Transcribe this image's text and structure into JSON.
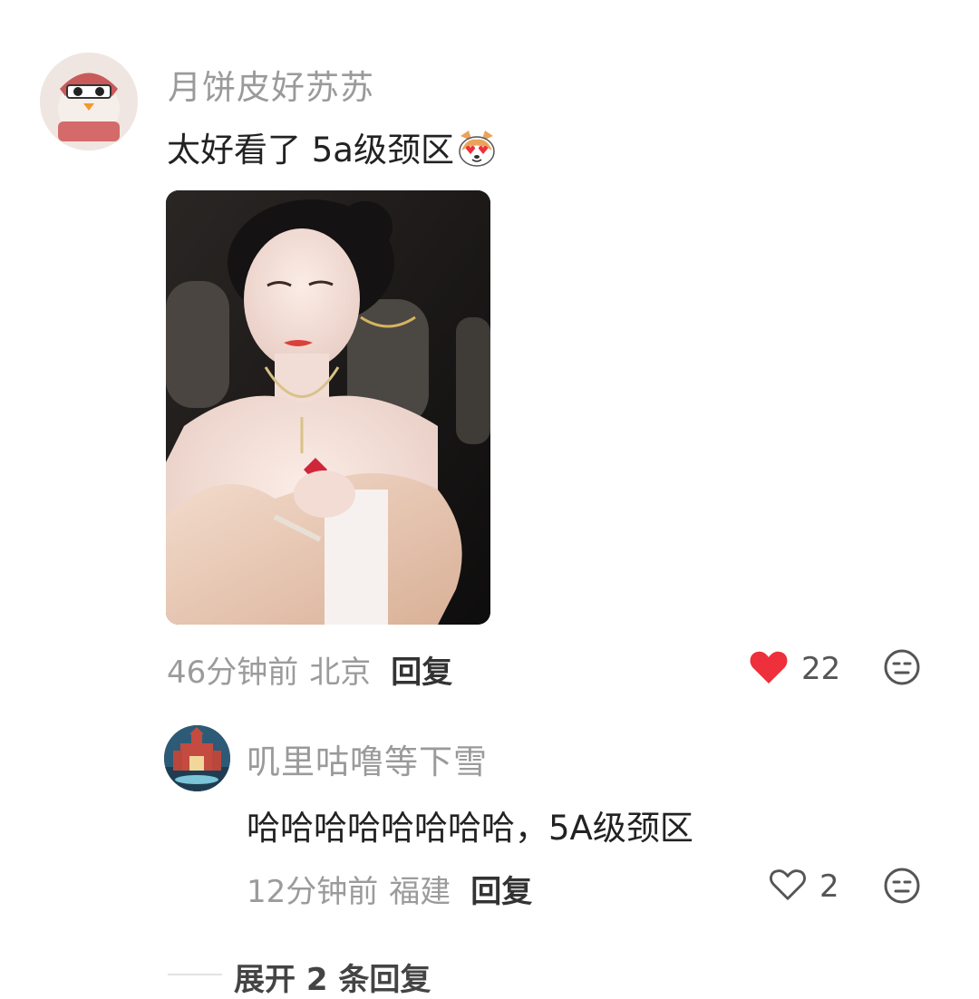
{
  "comments": [
    {
      "username": "月饼皮好苏苏",
      "text": "太好看了 5a级颈区",
      "emoji": "cat-heart-eyes-icon",
      "time": "46分钟前",
      "location": "北京",
      "reply_label": "回复",
      "likes": "22",
      "liked": true
    },
    {
      "username": "叽里咕噜等下雪",
      "text": "哈哈哈哈哈哈哈哈，5A级颈区",
      "time": "12分钟前",
      "location": "福建",
      "reply_label": "回复",
      "likes": "2",
      "liked": false
    }
  ],
  "expand_label": "展开 2 条回复",
  "colors": {
    "like_red": "#ee2f3c",
    "meta_gray": "#9b9b9b",
    "text": "#222222"
  }
}
